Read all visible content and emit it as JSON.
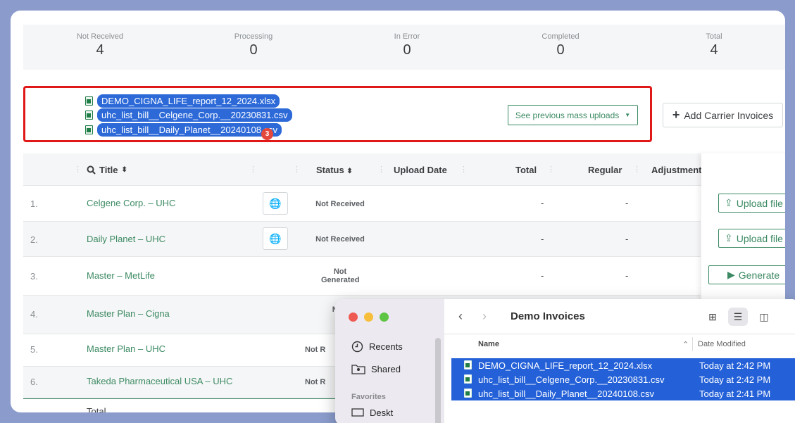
{
  "stats": [
    {
      "label": "Not Received",
      "value": "4"
    },
    {
      "label": "Processing",
      "value": "0"
    },
    {
      "label": "In Error",
      "value": "0"
    },
    {
      "label": "Completed",
      "value": "0"
    },
    {
      "label": "Total",
      "value": "4"
    }
  ],
  "drag": {
    "files": [
      "DEMO_CIGNA_LIFE_report_12_2024.xlsx",
      "uhc_list_bill__Celgene_Corp.__20230831.csv",
      "uhc_list_bill__Daily_Planet__20240108.csv"
    ],
    "count": "3"
  },
  "toolbar": {
    "prev_uploads": "See previous mass uploads",
    "add_carrier": "Add Carrier Invoices"
  },
  "table": {
    "headers": {
      "title": "Title",
      "status": "Status",
      "upload_date": "Upload Date",
      "total": "Total",
      "regular": "Regular",
      "adjustment": "Adjustment"
    },
    "rows": [
      {
        "num": "1.",
        "title": "Celgene Corp. – UHC",
        "status": "Not Received",
        "total": "-",
        "regular": "-",
        "action": "Upload file"
      },
      {
        "num": "2.",
        "title": "Daily Planet – UHC",
        "status": "Not Received",
        "total": "-",
        "regular": "-",
        "action": "Upload file"
      },
      {
        "num": "3.",
        "title": "Master – MetLife",
        "status": "Not Generated",
        "total": "-",
        "regular": "-",
        "action": "Generate"
      },
      {
        "num": "4.",
        "title": "Master Plan – Cigna",
        "status": "N Gen",
        "total": "",
        "regular": "",
        "action": ""
      },
      {
        "num": "5.",
        "title": "Master Plan – UHC",
        "status": "Not R",
        "total": "",
        "regular": "",
        "action": ""
      },
      {
        "num": "6.",
        "title": "Takeda Pharmaceutical USA – UHC",
        "status": "Not R",
        "total": "",
        "regular": "",
        "action": ""
      }
    ],
    "footer": "Total"
  },
  "finder": {
    "title": "Demo Invoices",
    "sidebar": [
      "Recents",
      "Shared"
    ],
    "favorites_label": "Favorites",
    "partial_item": "Deskt",
    "columns": {
      "name": "Name",
      "date": "Date Modified"
    },
    "files": [
      {
        "name": "DEMO_CIGNA_LIFE_report_12_2024.xlsx",
        "date": "Today at 2:42 PM"
      },
      {
        "name": "uhc_list_bill__Celgene_Corp.__20230831.csv",
        "date": "Today at 2:42 PM"
      },
      {
        "name": "uhc_list_bill__Daily_Planet__20240108.csv",
        "date": "Today at 2:41 PM"
      }
    ]
  },
  "colors": {
    "accent": "#3c8a63",
    "selection": "#2461d8",
    "drop_border": "#e01818"
  }
}
